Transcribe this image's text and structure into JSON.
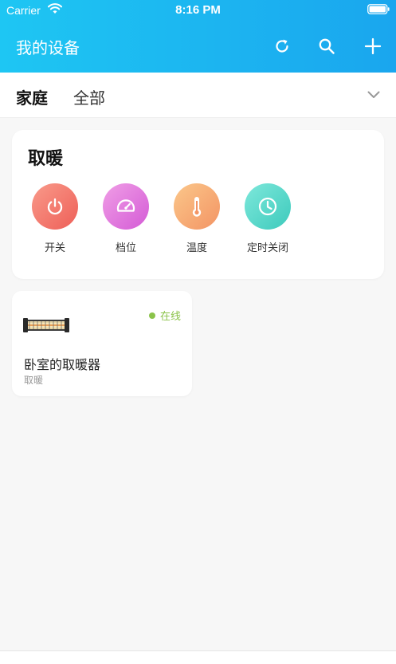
{
  "status_bar": {
    "carrier": "Carrier",
    "time": "8:16 PM"
  },
  "nav": {
    "title": "我的设备",
    "icons": [
      "refresh-icon",
      "search-icon",
      "plus-icon"
    ]
  },
  "tabs": {
    "active": "家庭",
    "inactive": "全部"
  },
  "quick_card": {
    "title": "取暖",
    "functions": [
      {
        "label": "开关",
        "icon": "power-icon",
        "color_from": "#f99a8a",
        "color_to": "#ee5f58"
      },
      {
        "label": "档位",
        "icon": "speedometer-icon",
        "color_from": "#f09ee6",
        "color_to": "#d45bd6"
      },
      {
        "label": "温度",
        "icon": "thermometer-icon",
        "color_from": "#fbc78a",
        "color_to": "#f39464"
      },
      {
        "label": "定时关闭",
        "icon": "clock-icon",
        "color_from": "#7ee8db",
        "color_to": "#3dcabc"
      }
    ]
  },
  "devices": [
    {
      "name": "卧室的取暖器",
      "type": "取暖",
      "status": "在线",
      "status_color": "#8bc34a"
    }
  ],
  "colors": {
    "header_from": "#1ec6f3",
    "header_to": "#1aa6ee",
    "accent": "#1aa6ee"
  }
}
